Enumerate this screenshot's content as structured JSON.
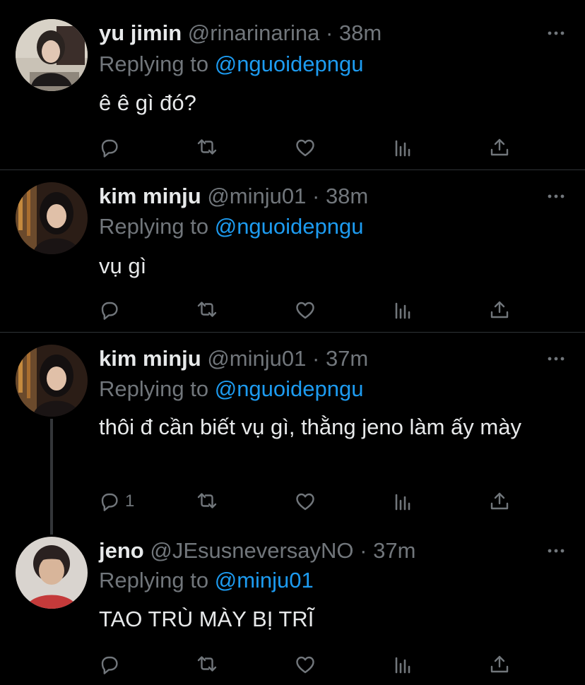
{
  "tweets": [
    {
      "name": "yu jimin",
      "handle": "@rinarinarina",
      "separator": "·",
      "time": "38m",
      "replying_prefix": "Replying to",
      "replying_to": "@nguoidepngu",
      "text": "ê ê gì đó?",
      "reply_count": ""
    },
    {
      "name": "kim minju",
      "handle": "@minju01",
      "separator": "·",
      "time": "38m",
      "replying_prefix": "Replying to",
      "replying_to": "@nguoidepngu",
      "text": "vụ gì",
      "reply_count": ""
    },
    {
      "name": "kim minju",
      "handle": "@minju01",
      "separator": "·",
      "time": "37m",
      "replying_prefix": "Replying to",
      "replying_to": "@nguoidepngu",
      "text": "thôi đ cần biết vụ gì, thằng jeno làm ấy mày",
      "reply_count": "1"
    },
    {
      "name": "jeno",
      "handle": "@JEsusneversayNO",
      "separator": "·",
      "time": "37m",
      "replying_prefix": "Replying to",
      "replying_to": "@minju01",
      "text": "TAO TRÙ MÀY BỊ TRĨ",
      "reply_count": ""
    }
  ],
  "colors": {
    "background": "#000000",
    "text": "#e7e9ea",
    "muted": "#71767b",
    "link": "#1d9bf0",
    "divider": "#2f3336"
  },
  "icons": [
    "more-icon",
    "reply-icon",
    "retweet-icon",
    "like-icon",
    "analytics-icon",
    "share-icon"
  ]
}
